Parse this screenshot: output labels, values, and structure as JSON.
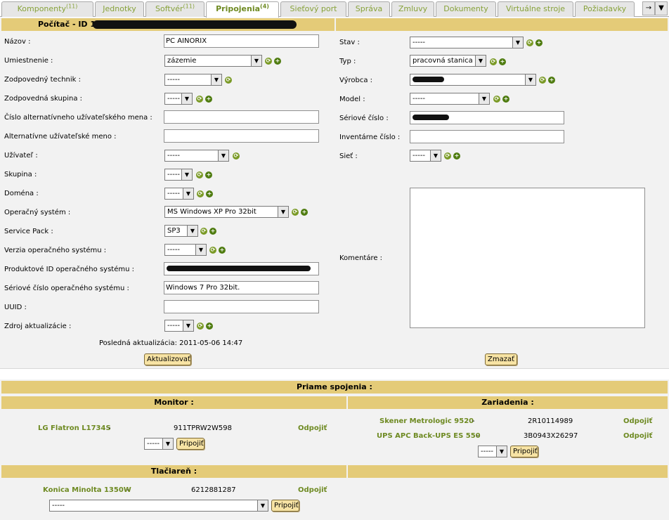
{
  "tabs": [
    {
      "label": "Komponenty",
      "count": "(11)"
    },
    {
      "label": "Jednotky",
      "count": ""
    },
    {
      "label": "Softvér",
      "count": "(11)"
    },
    {
      "label": "Pripojenia",
      "count": "(4)"
    },
    {
      "label": "Sieťový port",
      "count": ""
    },
    {
      "label": "Správa",
      "count": ""
    },
    {
      "label": "Zmluvy",
      "count": ""
    },
    {
      "label": "Dokumenty",
      "count": ""
    },
    {
      "label": "Virtuálne stroje",
      "count": ""
    },
    {
      "label": "Požiadavky",
      "count": ""
    }
  ],
  "tab_next": "→",
  "tab_overflow": "▼",
  "form": {
    "title": "Počítač - ID 1 (",
    "left": {
      "name_label": "Názov :",
      "name_value": "PC AINORIX",
      "location_label": "Umiestnenie :",
      "location_value": "zázemie",
      "tech_label": "Zodpovedný technik :",
      "tech_value": "-----",
      "group_resp_label": "Zodpovedná skupina :",
      "group_resp_value": "-----",
      "alt_user_num_label": "Číslo alternatívneho užívateľského mena :",
      "alt_user_num_value": "",
      "alt_user_label": "Alternatívne užívateľské meno :",
      "alt_user_value": "",
      "user_label": "Užívateľ :",
      "user_value": "-----",
      "group_label": "Skupina :",
      "group_value": "-----",
      "domain_label": "Doména :",
      "domain_value": "-----",
      "os_label": "Operačný systém :",
      "os_value": "MS Windows XP Pro 32bit",
      "sp_label": "Service Pack :",
      "sp_value": "SP3",
      "os_version_label": "Verzia operačného systému :",
      "os_version_value": "-----",
      "product_id_label": "Produktové ID operačného systému :",
      "os_serial_label": "Sériové číslo operačného systému :",
      "os_serial_value": "Windows 7 Pro 32bit.",
      "uuid_label": "UUID :",
      "uuid_value": "",
      "update_src_label": "Zdroj aktualizácie :",
      "update_src_value": "-----",
      "last_update": "Posledná aktualizácia: 2011-05-06 14:47",
      "update_button": "Aktualizovať"
    },
    "right": {
      "state_label": "Stav :",
      "state_value": "-----",
      "type_label": "Typ :",
      "type_value": "pracovná stanica",
      "maker_label": "Výrobca :",
      "model_label": "Model :",
      "model_value": "-----",
      "serial_label": "Sériové číslo :",
      "inventory_label": "Inventárne číslo :",
      "inventory_value": "",
      "network_label": "Sieť :",
      "network_value": "-----",
      "comments_label": "Komentáre :",
      "delete_button": "Zmazať"
    }
  },
  "connections": {
    "title": "Priame spojenia :",
    "monitor_header": "Monitor :",
    "devices_header": "Zariadenia :",
    "printer_header": "Tlačiareň :",
    "monitor": {
      "name": "LG Flatron L1734S",
      "sep": "-",
      "serial": "911TPRW2W598",
      "disconnect": "Odpojiť"
    },
    "devices": [
      {
        "name": "Skener Metrologic 9520",
        "sep": "-",
        "serial": "2R10114989",
        "disconnect": "Odpojiť"
      },
      {
        "name": "UPS APC Back-UPS ES 550",
        "sep": "-",
        "serial": "3B0943X26297",
        "disconnect": "Odpojiť"
      }
    ],
    "printer": {
      "name": "Konica Minolta 1350W",
      "sep": "-",
      "serial": "6212881287",
      "disconnect": "Odpojiť"
    },
    "select_value": "-----",
    "connect_button": "Pripojiť"
  },
  "colors": {
    "header_bg": "#e4cb78",
    "link_green": "#6e8a22",
    "panel_bg": "#f2f2f2",
    "button_bg": "#f7e3a4"
  }
}
